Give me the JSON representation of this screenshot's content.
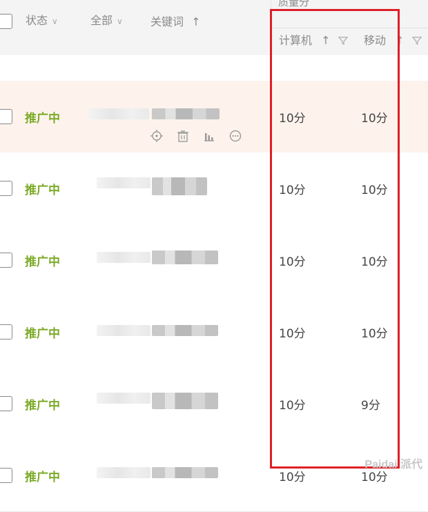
{
  "header": {
    "status_label": "状态",
    "all_label": "全部",
    "keyword_label": "关键词",
    "sort_arrow": "↑",
    "quality_group_label": "质量分",
    "pc_label": "计算机",
    "mobile_label": "移动"
  },
  "rows": [
    {
      "status": "推广中",
      "pc": "10分",
      "mobile": "10分"
    },
    {
      "status": "推广中",
      "pc": "10分",
      "mobile": "10分"
    },
    {
      "status": "推广中",
      "pc": "10分",
      "mobile": "10分"
    },
    {
      "status": "推广中",
      "pc": "10分",
      "mobile": "10分"
    },
    {
      "status": "推广中",
      "pc": "10分",
      "mobile": "9分"
    },
    {
      "status": "推广中",
      "pc": "10分",
      "mobile": "10分"
    }
  ],
  "watermark": "Paidai 派代",
  "colors": {
    "status_green": "#7cab28",
    "highlight_red": "#dd1f25",
    "row_highlight": "#fdf3ec"
  },
  "icons": [
    "target-icon",
    "trash-icon",
    "bar-chart-icon",
    "more-icon"
  ]
}
